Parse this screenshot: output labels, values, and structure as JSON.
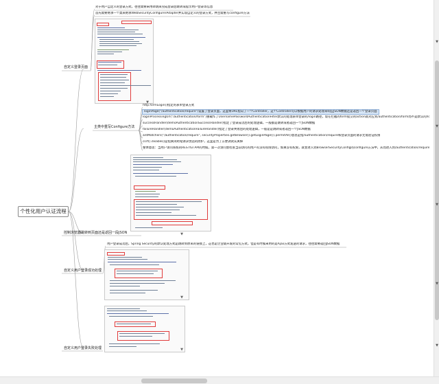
{
  "root": {
    "label": "个性化用户认证流程"
  },
  "branches": [
    {
      "id": "custom-login-page",
      "label": "自定义登录页面"
    },
    {
      "id": "configure-method",
      "label": "主类中重写Configure方法"
    },
    {
      "id": "jump-or-json",
      "label": "控制浏览器跳转到页面还是返回一段JSON"
    },
    {
      "id": "login-success",
      "label": "自定义用户登录成功处理"
    },
    {
      "id": "login-failure",
      "label": "自定义用户登录失败处理"
    }
  ],
  "leaves": {
    "custom_login_page": [
      "对于用户自定义的登录方式，往往需要采用转跳来完成登录后跳转或提示用户登录等信息",
      "首先需要继承一个类来继承WebSecurityConfigurerAdapter并实现自定义的登录方式，并且需重写configure方法"
    ],
    "configure_method": [
      "http.formLogin()指定的表单登录方式",
      "loginPage(\"/authentication/require\")设置了登录页面，这里将URL指向了一个Controller，这个Controller可以根据用户的请求处理来响应JSON数据还是返回一个登录页面",
      "loginProcessingUrl(\"/authentication/form\")重载作了UsernamePasswordAuthenticationFilter默认的处理表单登录的/login路径，现在拦截的form提交的action就对应到/authentication/form而不是默认的/login了",
      "successHandler(demoAuthenticationSuccessHandler)指定了登录成功后的处理逻辑，一般都是跳转或者返回一个JSON数据",
      "failureHandler(demoAuthenticationFailureHandler)指定了登录失败后的处理逻辑，一般是是跳转或者返回一个JSON数据",
      "antMatchers(\"/authentication/require\", securityProperties.getBrowser().getLoginPage()).permitAll()意思是指/authentication/require和登录页面的请求无需验证权限",
      "csrf().disable()是指关闭跨站请求伪造的防护，这里是为了方便调试先关掉",
      "整体意思：当用户访问系统的RESTful API的时候，第一次访问会检查当前访问的用户有没有权限访问，如果没有权限，就会进入到BrowserSecurityConfig的configure方法中，从而进入到/authentication/require的Controller"
    ],
    "jump_or_json": [],
    "login_success": [
      "用户登录成功后，Spring Security的默认处理方式是跳转到原来的链接上，这也是企业级开发的常见方式，但是有时候采用的是Ajax方式发送的请求，往往需要返回JSON数据"
    ],
    "login_failure": []
  },
  "scrollbars": {
    "vertical": "vertical-scrollbar",
    "horizontal": "horizontal-scrollbar"
  }
}
